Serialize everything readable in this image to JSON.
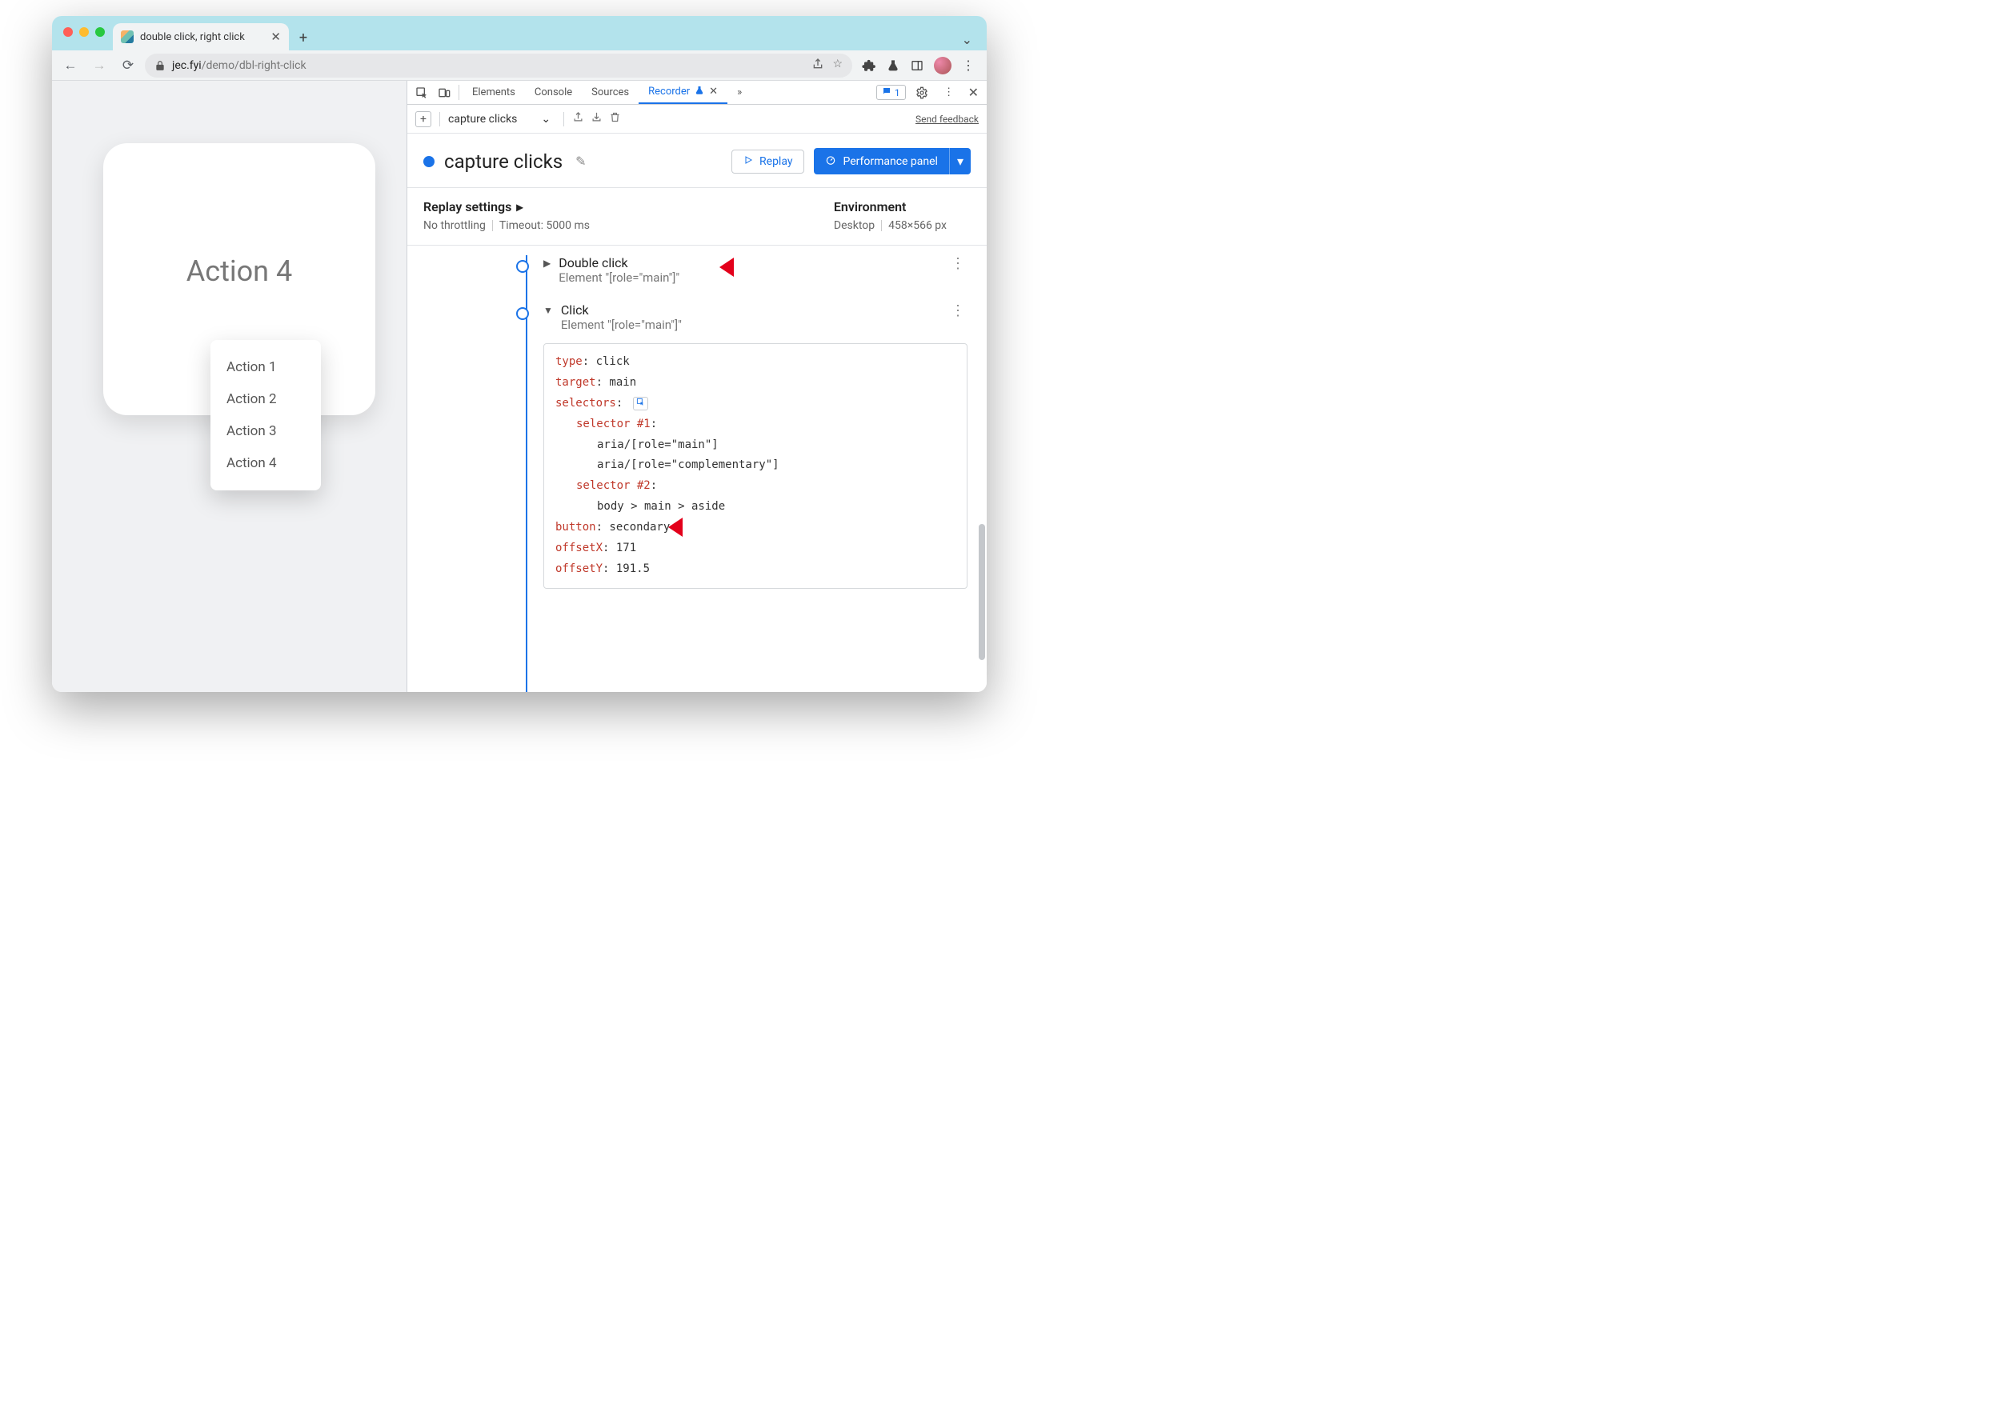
{
  "tab": {
    "title": "double click, right click"
  },
  "url": {
    "host": "jec.fyi",
    "path": "/demo/dbl-right-click"
  },
  "devtools": {
    "tabs": {
      "elements": "Elements",
      "console": "Console",
      "sources": "Sources",
      "recorder": "Recorder"
    },
    "issues_count": "1",
    "more_glyph": "»"
  },
  "recorder": {
    "dropdown_label": "capture clicks",
    "feedback": "Send feedback",
    "title": "capture clicks",
    "replay_btn": "Replay",
    "perf_btn": "Performance panel",
    "settings": {
      "heading": "Replay settings",
      "throttling": "No throttling",
      "timeout": "Timeout: 5000 ms"
    },
    "env": {
      "heading": "Environment",
      "device": "Desktop",
      "viewport": "458×566 px"
    }
  },
  "steps": {
    "s1": {
      "title": "Double click",
      "sub": "Element \"[role=\"main\"]\""
    },
    "s2": {
      "title": "Click",
      "sub": "Element \"[role=\"main\"]\""
    },
    "details": {
      "type_k": "type",
      "type_v": ": click",
      "target_k": "target",
      "target_v": ": main",
      "selectors_k": "selectors",
      "selectors_colon": ":",
      "sel1_k": "selector #1",
      "sel1_colon": ":",
      "sel1_a": "aria/[role=\"main\"]",
      "sel1_b": "aria/[role=\"complementary\"]",
      "sel2_k": "selector #2",
      "sel2_colon": ":",
      "sel2_a": "body > main > aside",
      "button_k": "button",
      "button_v": ": secondary",
      "ox_k": "offsetX",
      "ox_v": ": 171",
      "oy_k": "offsetY",
      "oy_v": ": 191.5"
    }
  },
  "page": {
    "card_title": "Action 4",
    "menu": {
      "a1": "Action 1",
      "a2": "Action 2",
      "a3": "Action 3",
      "a4": "Action 4"
    }
  }
}
